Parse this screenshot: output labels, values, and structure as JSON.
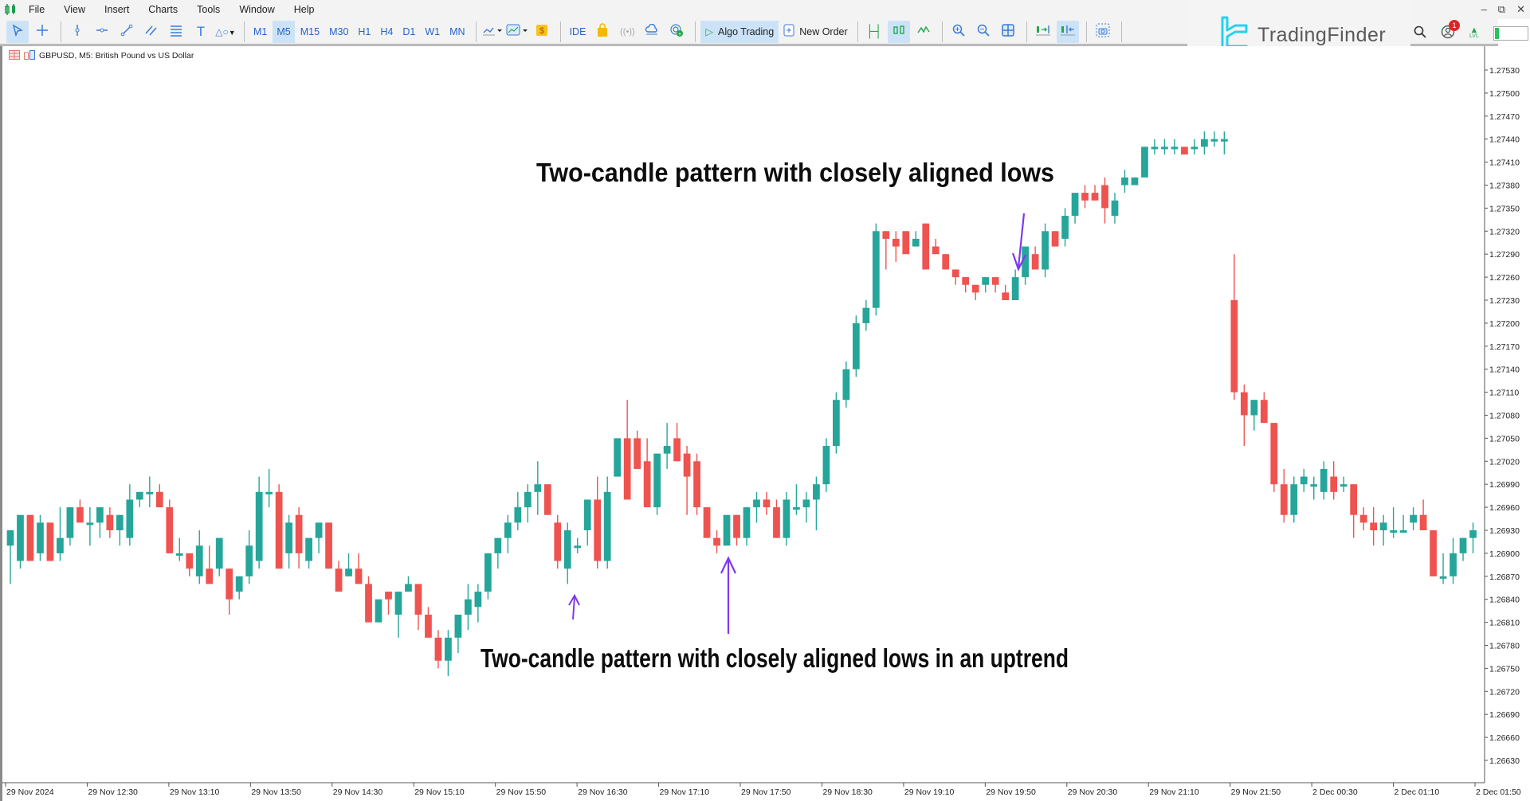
{
  "app": {
    "menu": [
      "File",
      "View",
      "Insert",
      "Charts",
      "Tools",
      "Window",
      "Help"
    ],
    "window_controls": [
      "minimize",
      "restore",
      "close"
    ]
  },
  "toolbar": {
    "tools": [
      {
        "icon": "cursor-icon",
        "active": true
      },
      {
        "icon": "crosshair-icon",
        "active": false
      },
      {
        "icon": "vertical-line-icon",
        "active": false
      },
      {
        "icon": "horizontal-line-icon",
        "active": false
      },
      {
        "icon": "trendline-icon",
        "active": false
      },
      {
        "icon": "channel-icon",
        "active": false
      },
      {
        "icon": "fibonacci-icon",
        "active": false
      },
      {
        "icon": "text-icon",
        "active": false
      },
      {
        "icon": "shapes-icon",
        "active": false
      }
    ],
    "timeframes": [
      "M1",
      "M5",
      "M15",
      "M30",
      "H1",
      "H4",
      "D1",
      "W1",
      "MN"
    ],
    "active_timeframe": "M5",
    "ide_label": "IDE",
    "algo_trading_label": "Algo Trading",
    "new_order_label": "New Order"
  },
  "brand": {
    "name": "TradingFinder",
    "color": "#22d3ee"
  },
  "rightbar": {
    "notification_count": "1",
    "level_label": "LVL"
  },
  "chart": {
    "header": "GBPUSD, M5:  British Pound vs US Dollar"
  },
  "annotations": {
    "top": "Two-candle pattern with closely aligned lows",
    "bottom": "Two-candle pattern with closely aligned lows in an uptrend"
  },
  "chart_data": {
    "type": "candlestick",
    "symbol": "GBPUSD",
    "timeframe": "M5",
    "title": "GBPUSD, M5: British Pound vs US Dollar",
    "ylim": [
      1.2661,
      1.2755
    ],
    "y_ticks": [
      "1.27530",
      "1.27500",
      "1.27470",
      "1.27440",
      "1.27410",
      "1.27380",
      "1.27350",
      "1.27320",
      "1.27290",
      "1.27260",
      "1.27230",
      "1.27200",
      "1.27170",
      "1.27140",
      "1.27110",
      "1.27080",
      "1.27050",
      "1.27020",
      "1.26990",
      "1.26960",
      "1.26930",
      "1.26900",
      "1.26870",
      "1.26840",
      "1.26810",
      "1.26780",
      "1.26750",
      "1.26720",
      "1.26690",
      "1.26660",
      "1.26630"
    ],
    "x_ticks": [
      "29 Nov 2024",
      "29 Nov 12:30",
      "29 Nov 13:10",
      "29 Nov 13:50",
      "29 Nov 14:30",
      "29 Nov 15:10",
      "29 Nov 15:50",
      "29 Nov 16:30",
      "29 Nov 17:10",
      "29 Nov 17:50",
      "29 Nov 18:30",
      "29 Nov 19:10",
      "29 Nov 19:50",
      "29 Nov 20:30",
      "29 Nov 21:10",
      "29 Nov 21:50",
      "2 Dec 00:30",
      "2 Dec 01:10",
      "2 Dec 01:50"
    ],
    "colors": {
      "bull": "#26a69a",
      "bear": "#ef5350",
      "dark_red": "#b22222",
      "crimson": "#dc143c",
      "blue": "#4169e1",
      "pure_blue": "#0000ff",
      "orange": "#ff6347",
      "gold": "#daa520",
      "annotation_arrow": "#7c3aed"
    },
    "candles": [
      {
        "o": 1.2691,
        "h": 1.2692,
        "l": 1.2686,
        "c": 1.2693
      },
      {
        "o": 1.2689,
        "h": 1.2695,
        "l": 1.2688,
        "c": 1.2695
      },
      {
        "o": 1.2695,
        "h": 1.2695,
        "l": 1.2689,
        "c": 1.2689
      },
      {
        "o": 1.269,
        "h": 1.2695,
        "l": 1.2689,
        "c": 1.2694
      },
      {
        "o": 1.2694,
        "h": 1.2694,
        "l": 1.2689,
        "c": 1.2689
      },
      {
        "o": 1.269,
        "h": 1.2696,
        "l": 1.2689,
        "c": 1.2692
      },
      {
        "o": 1.2692,
        "h": 1.2696,
        "l": 1.2691,
        "c": 1.2696
      },
      {
        "o": 1.2696,
        "h": 1.2697,
        "l": 1.2694,
        "c": 1.2694
      },
      {
        "o": 1.2694,
        "h": 1.2696,
        "l": 1.2691,
        "c": 1.2694
      },
      {
        "o": 1.2694,
        "h": 1.2696,
        "l": 1.2692,
        "c": 1.2696
      },
      {
        "o": 1.2695,
        "h": 1.2696,
        "l": 1.2692,
        "c": 1.2693
      },
      {
        "o": 1.2693,
        "h": 1.2695,
        "l": 1.2691,
        "c": 1.2695
      },
      {
        "o": 1.2692,
        "h": 1.2699,
        "l": 1.2691,
        "c": 1.2697
      },
      {
        "o": 1.2697,
        "h": 1.2698,
        "l": 1.2696,
        "c": 1.2698
      },
      {
        "o": 1.2698,
        "h": 1.27,
        "l": 1.2696,
        "c": 1.2698
      },
      {
        "o": 1.2698,
        "h": 1.2699,
        "l": 1.2696,
        "c": 1.2696
      },
      {
        "o": 1.2696,
        "h": 1.2697,
        "l": 1.269,
        "c": 1.269
      },
      {
        "o": 1.269,
        "h": 1.2692,
        "l": 1.2689,
        "c": 1.269
      },
      {
        "o": 1.269,
        "h": 1.269,
        "l": 1.2687,
        "c": 1.2688
      },
      {
        "o": 1.2687,
        "h": 1.2693,
        "l": 1.2686,
        "c": 1.2691
      },
      {
        "o": 1.2688,
        "h": 1.2691,
        "l": 1.2686,
        "c": 1.2686
      },
      {
        "o": 1.2688,
        "h": 1.2692,
        "l": 1.2687,
        "c": 1.2692
      },
      {
        "o": 1.2688,
        "h": 1.2688,
        "l": 1.2682,
        "c": 1.2684
      },
      {
        "o": 1.2685,
        "h": 1.2687,
        "l": 1.2684,
        "c": 1.2687
      },
      {
        "o": 1.2687,
        "h": 1.2693,
        "l": 1.2686,
        "c": 1.2691
      },
      {
        "o": 1.2689,
        "h": 1.27,
        "l": 1.2688,
        "c": 1.2698
      },
      {
        "o": 1.2698,
        "h": 1.2701,
        "l": 1.2696,
        "c": 1.2698
      },
      {
        "o": 1.2698,
        "h": 1.2699,
        "l": 1.2688,
        "c": 1.2688
      },
      {
        "o": 1.269,
        "h": 1.2695,
        "l": 1.2688,
        "c": 1.2694
      },
      {
        "o": 1.2695,
        "h": 1.2696,
        "l": 1.2688,
        "c": 1.269
      },
      {
        "o": 1.2689,
        "h": 1.2692,
        "l": 1.2688,
        "c": 1.2692
      },
      {
        "o": 1.2692,
        "h": 1.2694,
        "l": 1.269,
        "c": 1.2694
      },
      {
        "o": 1.2694,
        "h": 1.2694,
        "l": 1.2688,
        "c": 1.2688
      },
      {
        "o": 1.2688,
        "h": 1.2689,
        "l": 1.2685,
        "c": 1.2685
      },
      {
        "o": 1.2687,
        "h": 1.269,
        "l": 1.2687,
        "c": 1.2688
      },
      {
        "o": 1.2688,
        "h": 1.269,
        "l": 1.2686,
        "c": 1.2686
      },
      {
        "o": 1.2686,
        "h": 1.2687,
        "l": 1.2681,
        "c": 1.2681
      },
      {
        "o": 1.2681,
        "h": 1.2684,
        "l": 1.2681,
        "c": 1.2684
      },
      {
        "o": 1.2685,
        "h": 1.2685,
        "l": 1.2682,
        "c": 1.2684
      },
      {
        "o": 1.2682,
        "h": 1.2685,
        "l": 1.2679,
        "c": 1.2685
      },
      {
        "o": 1.2685,
        "h": 1.2687,
        "l": 1.2685,
        "c": 1.2686
      },
      {
        "o": 1.2686,
        "h": 1.2686,
        "l": 1.268,
        "c": 1.2682
      },
      {
        "o": 1.2682,
        "h": 1.2683,
        "l": 1.2679,
        "c": 1.2679
      },
      {
        "o": 1.2679,
        "h": 1.268,
        "l": 1.2675,
        "c": 1.2676
      },
      {
        "o": 1.2676,
        "h": 1.268,
        "l": 1.2674,
        "c": 1.2679
      },
      {
        "o": 1.2679,
        "h": 1.2682,
        "l": 1.2677,
        "c": 1.2682
      },
      {
        "o": 1.2682,
        "h": 1.2686,
        "l": 1.268,
        "c": 1.2684
      },
      {
        "o": 1.2683,
        "h": 1.2686,
        "l": 1.2681,
        "c": 1.2685
      },
      {
        "o": 1.2685,
        "h": 1.269,
        "l": 1.2684,
        "c": 1.269
      },
      {
        "o": 1.269,
        "h": 1.2692,
        "l": 1.2688,
        "c": 1.2692
      },
      {
        "o": 1.2692,
        "h": 1.2695,
        "l": 1.269,
        "c": 1.2694
      },
      {
        "o": 1.2694,
        "h": 1.2698,
        "l": 1.2693,
        "c": 1.2696
      },
      {
        "o": 1.2696,
        "h": 1.2699,
        "l": 1.2694,
        "c": 1.2698
      },
      {
        "o": 1.2698,
        "h": 1.2702,
        "l": 1.2695,
        "c": 1.2699
      },
      {
        "o": 1.2699,
        "h": 1.2699,
        "l": 1.2696,
        "c": 1.2695
      },
      {
        "o": 1.2694,
        "h": 1.2695,
        "l": 1.2688,
        "c": 1.2689
      },
      {
        "o": 1.2688,
        "h": 1.2694,
        "l": 1.2686,
        "c": 1.2693
      },
      {
        "o": 1.2691,
        "h": 1.2692,
        "l": 1.269,
        "c": 1.2691
      },
      {
        "o": 1.2693,
        "h": 1.2697,
        "l": 1.2691,
        "c": 1.2697
      },
      {
        "o": 1.2697,
        "h": 1.27,
        "l": 1.2688,
        "c": 1.2689
      },
      {
        "o": 1.2689,
        "h": 1.27,
        "l": 1.2688,
        "c": 1.2698
      },
      {
        "o": 1.27,
        "h": 1.2701,
        "l": 1.27,
        "c": 1.2705
      },
      {
        "o": 1.2705,
        "h": 1.271,
        "l": 1.2697,
        "c": 1.2697
      },
      {
        "o": 1.2705,
        "h": 1.2706,
        "l": 1.2702,
        "c": 1.2701
      },
      {
        "o": 1.2702,
        "h": 1.2705,
        "l": 1.2696,
        "c": 1.2696
      },
      {
        "o": 1.2696,
        "h": 1.2703,
        "l": 1.2695,
        "c": 1.2703
      },
      {
        "o": 1.2703,
        "h": 1.2707,
        "l": 1.2701,
        "c": 1.2704
      },
      {
        "o": 1.2705,
        "h": 1.2707,
        "l": 1.2702,
        "c": 1.2702
      },
      {
        "o": 1.2703,
        "h": 1.2704,
        "l": 1.2695,
        "c": 1.27
      },
      {
        "o": 1.2702,
        "h": 1.2703,
        "l": 1.2695,
        "c": 1.2696
      },
      {
        "o": 1.2696,
        "h": 1.2696,
        "l": 1.2692,
        "c": 1.2692
      },
      {
        "o": 1.2692,
        "h": 1.2693,
        "l": 1.269,
        "c": 1.2691
      },
      {
        "o": 1.2691,
        "h": 1.2695,
        "l": 1.2691,
        "c": 1.2695
      },
      {
        "o": 1.2695,
        "h": 1.2695,
        "l": 1.2691,
        "c": 1.2692
      },
      {
        "o": 1.2692,
        "h": 1.2696,
        "l": 1.2691,
        "c": 1.2696
      },
      {
        "o": 1.2696,
        "h": 1.2698,
        "l": 1.2694,
        "c": 1.2697
      },
      {
        "o": 1.2697,
        "h": 1.2698,
        "l": 1.2695,
        "c": 1.2696
      },
      {
        "o": 1.2696,
        "h": 1.2697,
        "l": 1.2692,
        "c": 1.2692
      },
      {
        "o": 1.2692,
        "h": 1.2698,
        "l": 1.2691,
        "c": 1.2697
      },
      {
        "o": 1.2696,
        "h": 1.2699,
        "l": 1.2695,
        "c": 1.2696
      },
      {
        "o": 1.2696,
        "h": 1.2698,
        "l": 1.2694,
        "c": 1.2697
      },
      {
        "o": 1.2697,
        "h": 1.27,
        "l": 1.2693,
        "c": 1.2699
      },
      {
        "o": 1.2699,
        "h": 1.2705,
        "l": 1.2698,
        "c": 1.2704
      },
      {
        "o": 1.2704,
        "h": 1.2711,
        "l": 1.2703,
        "c": 1.271
      },
      {
        "o": 1.271,
        "h": 1.2715,
        "l": 1.2709,
        "c": 1.2714
      },
      {
        "o": 1.2714,
        "h": 1.2721,
        "l": 1.2713,
        "c": 1.272
      },
      {
        "o": 1.272,
        "h": 1.2723,
        "l": 1.2719,
        "c": 1.2722
      },
      {
        "o": 1.2722,
        "h": 1.2733,
        "l": 1.2721,
        "c": 1.2732
      },
      {
        "o": 1.2732,
        "h": 1.2732,
        "l": 1.2727,
        "c": 1.2731
      },
      {
        "o": 1.2731,
        "h": 1.2732,
        "l": 1.2728,
        "c": 1.273
      },
      {
        "o": 1.2732,
        "h": 1.2732,
        "l": 1.2729,
        "c": 1.2729
      },
      {
        "o": 1.273,
        "h": 1.2732,
        "l": 1.273,
        "c": 1.2731
      },
      {
        "o": 1.2733,
        "h": 1.2733,
        "l": 1.2727,
        "c": 1.2727
      },
      {
        "o": 1.273,
        "h": 1.2731,
        "l": 1.2729,
        "c": 1.2729
      },
      {
        "o": 1.2729,
        "h": 1.2729,
        "l": 1.2727,
        "c": 1.2727
      },
      {
        "o": 1.2727,
        "h": 1.2727,
        "l": 1.2725,
        "c": 1.2726
      },
      {
        "o": 1.2726,
        "h": 1.2726,
        "l": 1.2724,
        "c": 1.2725
      },
      {
        "o": 1.2725,
        "h": 1.2725,
        "l": 1.2723,
        "c": 1.2724
      },
      {
        "o": 1.2725,
        "h": 1.2726,
        "l": 1.2724,
        "c": 1.2726
      },
      {
        "o": 1.2726,
        "h": 1.2726,
        "l": 1.2724,
        "c": 1.2725
      },
      {
        "o": 1.2724,
        "h": 1.2725,
        "l": 1.2723,
        "c": 1.2723
      },
      {
        "o": 1.2723,
        "h": 1.2727,
        "l": 1.2723,
        "c": 1.2726
      },
      {
        "o": 1.2726,
        "h": 1.273,
        "l": 1.2725,
        "c": 1.273
      },
      {
        "o": 1.2729,
        "h": 1.273,
        "l": 1.2727,
        "c": 1.2727
      },
      {
        "o": 1.2727,
        "h": 1.2733,
        "l": 1.2726,
        "c": 1.2732
      },
      {
        "o": 1.2732,
        "h": 1.2732,
        "l": 1.273,
        "c": 1.273
      },
      {
        "o": 1.2731,
        "h": 1.2735,
        "l": 1.273,
        "c": 1.2734
      },
      {
        "o": 1.2734,
        "h": 1.2737,
        "l": 1.2733,
        "c": 1.2737
      },
      {
        "o": 1.2737,
        "h": 1.2738,
        "l": 1.2735,
        "c": 1.2736
      },
      {
        "o": 1.2737,
        "h": 1.2738,
        "l": 1.2736,
        "c": 1.2736
      },
      {
        "o": 1.2738,
        "h": 1.2739,
        "l": 1.2733,
        "c": 1.2735
      },
      {
        "o": 1.2734,
        "h": 1.2737,
        "l": 1.2733,
        "c": 1.2736
      },
      {
        "o": 1.2738,
        "h": 1.274,
        "l": 1.2737,
        "c": 1.2739
      },
      {
        "o": 1.2738,
        "h": 1.2739,
        "l": 1.2738,
        "c": 1.2739
      },
      {
        "o": 1.2739,
        "h": 1.2743,
        "l": 1.2739,
        "c": 1.2743
      },
      {
        "o": 1.2743,
        "h": 1.2744,
        "l": 1.2742,
        "c": 1.2743
      },
      {
        "o": 1.2743,
        "h": 1.2744,
        "l": 1.2742,
        "c": 1.2743
      },
      {
        "o": 1.2743,
        "h": 1.2744,
        "l": 1.2742,
        "c": 1.2743
      },
      {
        "o": 1.2743,
        "h": 1.2743,
        "l": 1.2742,
        "c": 1.2742
      },
      {
        "o": 1.2743,
        "h": 1.2744,
        "l": 1.2742,
        "c": 1.2743
      },
      {
        "o": 1.2743,
        "h": 1.2745,
        "l": 1.2742,
        "c": 1.2744
      },
      {
        "o": 1.2744,
        "h": 1.2745,
        "l": 1.2743,
        "c": 1.2744
      },
      {
        "o": 1.2744,
        "h": 1.2745,
        "l": 1.2742,
        "c": 1.2744
      },
      {
        "o": 1.2723,
        "h": 1.2729,
        "l": 1.271,
        "c": 1.2711
      },
      {
        "o": 1.2711,
        "h": 1.2712,
        "l": 1.2704,
        "c": 1.2708
      },
      {
        "o": 1.2708,
        "h": 1.271,
        "l": 1.2706,
        "c": 1.271
      },
      {
        "o": 1.271,
        "h": 1.2711,
        "l": 1.2707,
        "c": 1.2707
      },
      {
        "o": 1.2707,
        "h": 1.2707,
        "l": 1.2698,
        "c": 1.2699
      },
      {
        "o": 1.2699,
        "h": 1.2701,
        "l": 1.2694,
        "c": 1.2695
      },
      {
        "o": 1.2695,
        "h": 1.27,
        "l": 1.2694,
        "c": 1.2699
      },
      {
        "o": 1.2699,
        "h": 1.2701,
        "l": 1.2698,
        "c": 1.27
      },
      {
        "o": 1.2699,
        "h": 1.27,
        "l": 1.2697,
        "c": 1.2699
      },
      {
        "o": 1.2698,
        "h": 1.2702,
        "l": 1.2697,
        "c": 1.2701
      },
      {
        "o": 1.27,
        "h": 1.2702,
        "l": 1.2697,
        "c": 1.2698
      },
      {
        "o": 1.2699,
        "h": 1.27,
        "l": 1.2698,
        "c": 1.2699
      },
      {
        "o": 1.2699,
        "h": 1.2699,
        "l": 1.2692,
        "c": 1.2695
      },
      {
        "o": 1.2695,
        "h": 1.2696,
        "l": 1.2693,
        "c": 1.2694
      },
      {
        "o": 1.2694,
        "h": 1.2696,
        "l": 1.2691,
        "c": 1.2693
      },
      {
        "o": 1.2693,
        "h": 1.2695,
        "l": 1.2691,
        "c": 1.2694
      },
      {
        "o": 1.2693,
        "h": 1.2696,
        "l": 1.2692,
        "c": 1.2693
      },
      {
        "o": 1.2693,
        "h": 1.2695,
        "l": 1.2693,
        "c": 1.2693
      },
      {
        "o": 1.2694,
        "h": 1.2696,
        "l": 1.2693,
        "c": 1.2695
      },
      {
        "o": 1.2695,
        "h": 1.2697,
        "l": 1.2693,
        "c": 1.2693
      },
      {
        "o": 1.2693,
        "h": 1.2693,
        "l": 1.2687,
        "c": 1.2687
      },
      {
        "o": 1.2687,
        "h": 1.269,
        "l": 1.2686,
        "c": 1.2687
      },
      {
        "o": 1.2687,
        "h": 1.2692,
        "l": 1.2686,
        "c": 1.269
      },
      {
        "o": 1.269,
        "h": 1.2692,
        "l": 1.2689,
        "c": 1.2692
      },
      {
        "o": 1.2692,
        "h": 1.2694,
        "l": 1.269,
        "c": 1.2693
      }
    ],
    "annotations": [
      {
        "text": "Two-candle pattern with closely aligned lows",
        "points_to_price": 1.2723
      },
      {
        "text": "Two-candle pattern with closely aligned lows in an uptrend",
        "points_to_prices": [
          1.2685,
          1.2691
        ]
      }
    ]
  }
}
